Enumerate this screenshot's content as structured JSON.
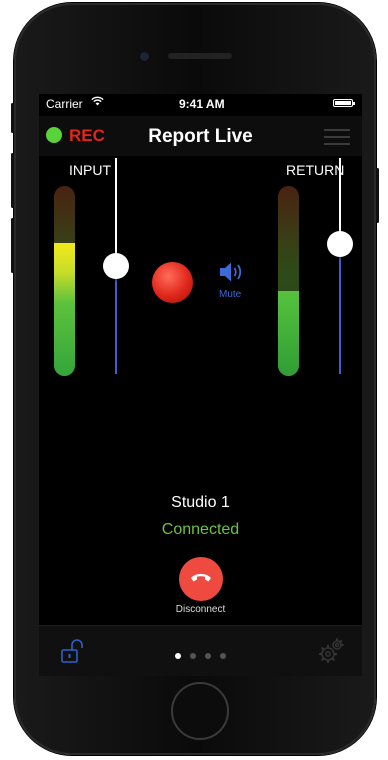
{
  "status_bar": {
    "carrier": "Carrier",
    "time": "9:41 AM"
  },
  "nav": {
    "rec_label": "REC",
    "title": "Report Live"
  },
  "meters": {
    "input_label": "INPUT",
    "return_label": "RETURN",
    "input_level": 0.7,
    "return_level": 0.45,
    "input_slider": 0.5,
    "return_slider": 0.6
  },
  "controls": {
    "mute_label": "Mute"
  },
  "call": {
    "studio": "Studio 1",
    "status": "Connected",
    "disconnect_label": "Disconnect"
  },
  "pager": {
    "count": 4,
    "active": 0
  },
  "colors": {
    "rec_green": "#5ad23a",
    "rec_red": "#e0261b",
    "connected_green": "#6cc23f",
    "hangup_red": "#ee4a3f",
    "accent_blue": "#3a6bd6"
  }
}
